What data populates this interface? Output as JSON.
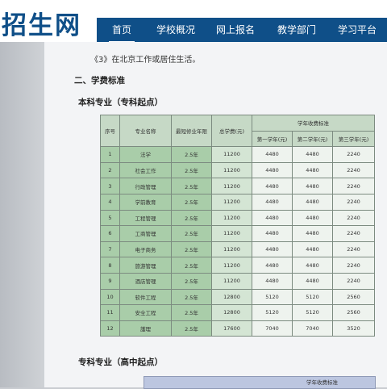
{
  "site": {
    "title": "招生网"
  },
  "nav": {
    "items": [
      "首页",
      "学校概况",
      "网上报名",
      "教学部门",
      "学习平台"
    ]
  },
  "content": {
    "intro_line": "《3》在北京工作或居住生活。",
    "section_title": "二、学费标准",
    "undergrad_title": "本科专业（专科起点）",
    "college_title": "专科专业（高中起点）",
    "college_table_header": "学年收费标准"
  },
  "fee_table": {
    "headers": {
      "num": "序号",
      "major": "专业名称",
      "years": "最短修业年限",
      "total": "总学费(元)",
      "group": "学年收费标准",
      "y1": "第一学年(元)",
      "y2": "第二学年(元)",
      "y3": "第三学年(元)"
    },
    "rows": [
      [
        "1",
        "法学",
        "2.5年",
        "11200",
        "4480",
        "4480",
        "2240"
      ],
      [
        "2",
        "社会工作",
        "2.5年",
        "11200",
        "4480",
        "4480",
        "2240"
      ],
      [
        "3",
        "行政管理",
        "2.5年",
        "11200",
        "4480",
        "4480",
        "2240"
      ],
      [
        "4",
        "学前教育",
        "2.5年",
        "11200",
        "4480",
        "4480",
        "2240"
      ],
      [
        "5",
        "工程管理",
        "2.5年",
        "11200",
        "4480",
        "4480",
        "2240"
      ],
      [
        "6",
        "工商管理",
        "2.5年",
        "11200",
        "4480",
        "4480",
        "2240"
      ],
      [
        "7",
        "电子商务",
        "2.5年",
        "11200",
        "4480",
        "4480",
        "2240"
      ],
      [
        "8",
        "旅游管理",
        "2.5年",
        "11200",
        "4480",
        "4480",
        "2240"
      ],
      [
        "9",
        "酒店管理",
        "2.5年",
        "11200",
        "4480",
        "4480",
        "2240"
      ],
      [
        "10",
        "软件工程",
        "2.5年",
        "12800",
        "5120",
        "5120",
        "2560"
      ],
      [
        "11",
        "安全工程",
        "2.5年",
        "12800",
        "5120",
        "5120",
        "2560"
      ],
      [
        "12",
        "護理",
        "2.5年",
        "17600",
        "7040",
        "7040",
        "3520"
      ]
    ]
  }
}
